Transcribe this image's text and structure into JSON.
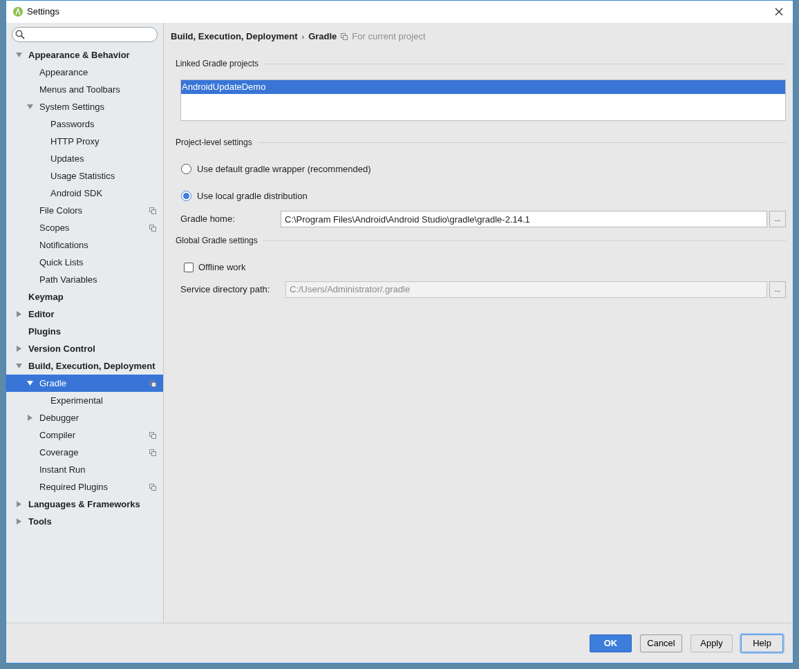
{
  "window": {
    "title": "Settings"
  },
  "sidebar": {
    "items": [
      {
        "label": "Appearance & Behavior",
        "expanded": true,
        "selected": false,
        "project_scoped": false,
        "children": [
          {
            "label": "Appearance",
            "selected": false,
            "project_scoped": false
          },
          {
            "label": "Menus and Toolbars",
            "selected": false,
            "project_scoped": false
          },
          {
            "label": "System Settings",
            "expanded": true,
            "selected": false,
            "project_scoped": false,
            "children": [
              {
                "label": "Passwords",
                "selected": false,
                "project_scoped": false
              },
              {
                "label": "HTTP Proxy",
                "selected": false,
                "project_scoped": false
              },
              {
                "label": "Updates",
                "selected": false,
                "project_scoped": false
              },
              {
                "label": "Usage Statistics",
                "selected": false,
                "project_scoped": false
              },
              {
                "label": "Android SDK",
                "selected": false,
                "project_scoped": false
              }
            ]
          },
          {
            "label": "File Colors",
            "selected": false,
            "project_scoped": true
          },
          {
            "label": "Scopes",
            "selected": false,
            "project_scoped": true
          },
          {
            "label": "Notifications",
            "selected": false,
            "project_scoped": false
          },
          {
            "label": "Quick Lists",
            "selected": false,
            "project_scoped": false
          },
          {
            "label": "Path Variables",
            "selected": false,
            "project_scoped": false
          }
        ]
      },
      {
        "label": "Keymap",
        "selected": false,
        "project_scoped": false
      },
      {
        "label": "Editor",
        "expanded": false,
        "selected": false,
        "project_scoped": false
      },
      {
        "label": "Plugins",
        "selected": false,
        "project_scoped": false
      },
      {
        "label": "Version Control",
        "expanded": false,
        "selected": false,
        "project_scoped": false
      },
      {
        "label": "Build, Execution, Deployment",
        "expanded": true,
        "selected": false,
        "project_scoped": false,
        "children": [
          {
            "label": "Gradle",
            "expanded": true,
            "selected": true,
            "project_scoped": true,
            "children": [
              {
                "label": "Experimental",
                "selected": false,
                "project_scoped": false
              }
            ]
          },
          {
            "label": "Debugger",
            "expanded": false,
            "selected": false,
            "project_scoped": false
          },
          {
            "label": "Compiler",
            "selected": false,
            "project_scoped": true
          },
          {
            "label": "Coverage",
            "selected": false,
            "project_scoped": true
          },
          {
            "label": "Instant Run",
            "selected": false,
            "project_scoped": false
          },
          {
            "label": "Required Plugins",
            "selected": false,
            "project_scoped": true
          }
        ]
      },
      {
        "label": "Languages & Frameworks",
        "expanded": false,
        "selected": false,
        "project_scoped": false
      },
      {
        "label": "Tools",
        "expanded": false,
        "selected": false,
        "project_scoped": false
      }
    ]
  },
  "breadcrumb": {
    "parent": "Build, Execution, Deployment",
    "separator": "›",
    "current": "Gradle",
    "scope_note": "For current project"
  },
  "linked_projects": {
    "heading": "Linked Gradle projects",
    "items": [
      {
        "label": "AndroidUpdateDemo",
        "selected": true
      }
    ]
  },
  "project_settings": {
    "heading": "Project-level settings",
    "options": [
      {
        "label": "Use default gradle wrapper (recommended)",
        "selected": false
      },
      {
        "label": "Use local gradle distribution",
        "selected": true
      }
    ],
    "gradle_home": {
      "label": "Gradle home:",
      "value": "C:\\Program Files\\Android\\Android Studio\\gradle\\gradle-2.14.1",
      "browse": "..."
    }
  },
  "global_settings": {
    "heading": "Global Gradle settings",
    "offline_work": {
      "label": "Offline work",
      "checked": false
    },
    "service_dir": {
      "label": "Service directory path:",
      "placeholder": "C:/Users/Administrator/.gradle",
      "browse": "..."
    }
  },
  "buttons": [
    {
      "label": "OK",
      "kind": "primary",
      "disabled": false
    },
    {
      "label": "Cancel",
      "kind": "normal",
      "disabled": false
    },
    {
      "label": "Apply",
      "kind": "normal",
      "disabled": true
    },
    {
      "label": "Help",
      "kind": "focused",
      "disabled": false
    }
  ]
}
